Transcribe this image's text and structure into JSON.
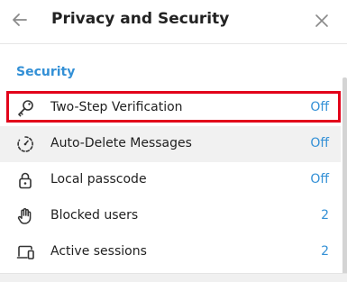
{
  "header": {
    "title": "Privacy and Security",
    "back_icon": "arrow-left-icon",
    "close_icon": "close-icon"
  },
  "security": {
    "section_title": "Security",
    "items": [
      {
        "label": "Two-Step Verification",
        "value": "Off",
        "icon": "key-icon"
      },
      {
        "label": "Auto-Delete Messages",
        "value": "Off",
        "icon": "timer-icon"
      },
      {
        "label": "Local passcode",
        "value": "Off",
        "icon": "lock-icon"
      },
      {
        "label": "Blocked users",
        "value": "2",
        "icon": "hand-icon"
      },
      {
        "label": "Active sessions",
        "value": "2",
        "icon": "devices-icon"
      }
    ]
  },
  "colors": {
    "accent": "#3390d6",
    "highlight_box": "#e2001a",
    "hover_row": "#f1f1f1"
  }
}
